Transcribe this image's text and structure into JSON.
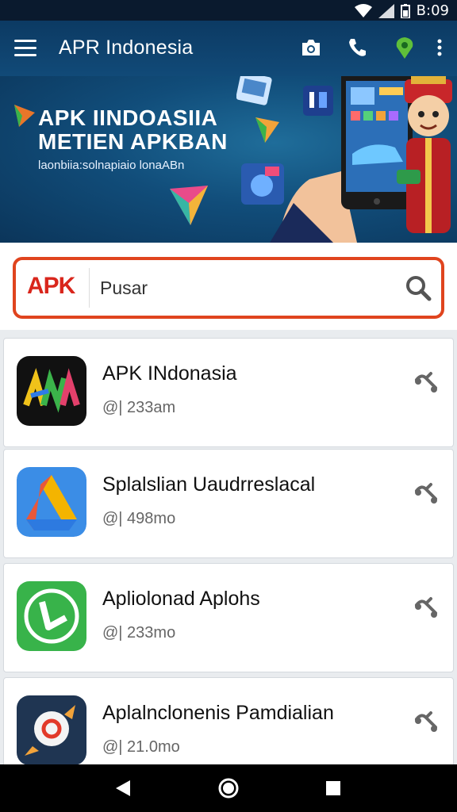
{
  "status_bar": {
    "time": "B:09"
  },
  "app_bar": {
    "title": "APR Indonesia",
    "actions": [
      "camera-icon",
      "phone-icon",
      "location-icon",
      "more-vert-icon"
    ]
  },
  "banner": {
    "headline_line1": "APK IINDOASIIA",
    "headline_line2": "METIEN APKBAN",
    "tagline": "laonbiia:solnapiaio lonaABn"
  },
  "search": {
    "logo_text": "APK",
    "query": "Pusar"
  },
  "apps": [
    {
      "name": "APK INdonasia",
      "meta": "@| 233am",
      "icon": "apk-indonesia-icon"
    },
    {
      "name": "Splalslian Uaudrreslacal",
      "meta": "@| 498mo",
      "icon": "drive-icon"
    },
    {
      "name": "Apliolonad Aplohs",
      "meta": "@| 233mo",
      "icon": "green-app-icon"
    },
    {
      "name": "Aplalnclonenis Pamdialian",
      "meta": "@| 21.0mo",
      "icon": "rocket-icon"
    }
  ],
  "colors": {
    "app_bar": "#0c3a63",
    "search_border": "#e0441e",
    "logo_red": "#d9261c"
  },
  "nav_bar": [
    "back-icon",
    "home-icon",
    "recents-icon"
  ]
}
